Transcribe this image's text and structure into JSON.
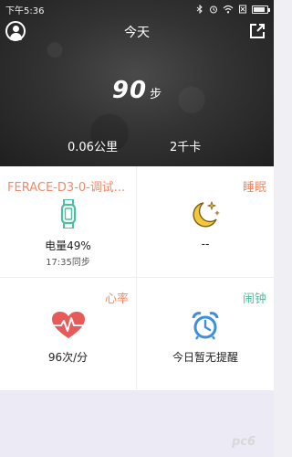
{
  "status_bar": {
    "time": "下午5:36"
  },
  "header": {
    "title": "今天"
  },
  "summary": {
    "steps": "90",
    "steps_unit": "步",
    "distance": "0.06公里",
    "calories": "2千卡"
  },
  "cards": {
    "device": {
      "title": "FERACE-D3-0-调试...",
      "battery": "电量49%",
      "sync": "17:35同步",
      "color": "#f08a6a",
      "icon": "watch-icon"
    },
    "sleep": {
      "title": "睡眠",
      "value": "--",
      "color": "#f08a6a",
      "icon": "moon-icon"
    },
    "heart": {
      "title": "心率",
      "value": "96次/分",
      "color": "#f08a6a",
      "icon": "heart-rate-icon"
    },
    "alarm": {
      "title": "闹钟",
      "value": "今日暂无提醒",
      "color": "#4bbfa0",
      "icon": "alarm-clock-icon"
    }
  },
  "watermark": {
    "text": "pc6"
  }
}
